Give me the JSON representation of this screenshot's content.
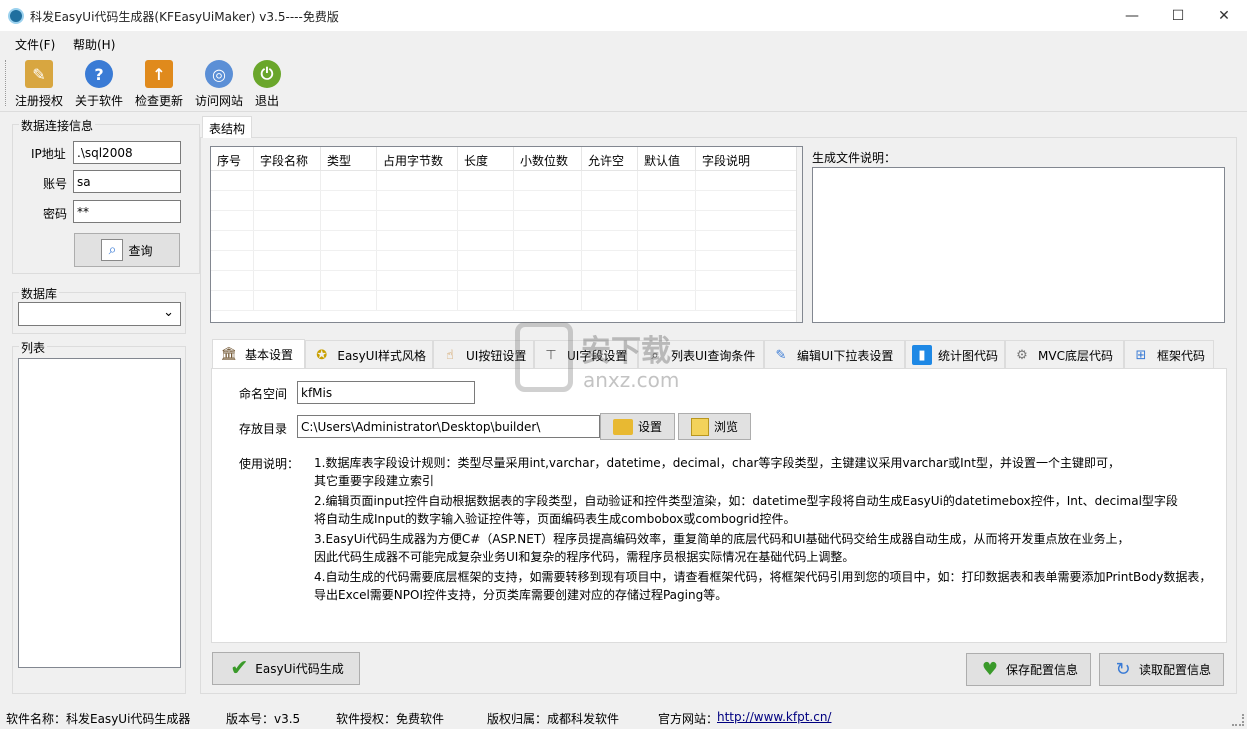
{
  "window": {
    "title": "科发EasyUi代码生成器(KFEasyUiMaker) v3.5----免费版",
    "min": "—",
    "max": "☐",
    "close": "✕"
  },
  "menu": [
    "文件(F)",
    "帮助(H)"
  ],
  "toolbar": [
    {
      "label": "注册授权",
      "icon": "key-document-icon",
      "color": "#d8a640",
      "glyph": "✎"
    },
    {
      "label": "关于软件",
      "icon": "help-icon",
      "color": "#3a7bd5",
      "glyph": "?"
    },
    {
      "label": "检查更新",
      "icon": "update-icon",
      "color": "#e08a1c",
      "glyph": "↑"
    },
    {
      "label": "访问网站",
      "icon": "globe-icon",
      "color": "#5b8fd6",
      "glyph": "◎"
    },
    {
      "label": "退出",
      "icon": "exit-icon",
      "color": "#6aa62b",
      "glyph": "⏻"
    }
  ],
  "connection": {
    "title": "数据连接信息",
    "ip_label": "IP地址",
    "ip_value": ".\\sql2008",
    "user_label": "账号",
    "user_value": "sa",
    "pwd_label": "密码",
    "pwd_value": "**",
    "query_button": "查询"
  },
  "database": {
    "title": "数据库",
    "selected": ""
  },
  "tables": {
    "title": "列表"
  },
  "structure": {
    "tab": "表结构",
    "columns": [
      "序号",
      "字段名称",
      "类型",
      "占用字节数",
      "长度",
      "小数位数",
      "允许空",
      "默认值",
      "字段说明"
    ]
  },
  "output_desc": {
    "label": "生成文件说明："
  },
  "tabs": [
    {
      "label": "基本设置",
      "icon": "bank-icon"
    },
    {
      "label": "EasyUI样式风格",
      "icon": "medal-icon"
    },
    {
      "label": "UI按钮设置",
      "icon": "pointer-hand-icon"
    },
    {
      "label": "UI字段设置",
      "icon": "pin-icon"
    },
    {
      "label": "列表UI查询条件",
      "icon": "magnifier-icon"
    },
    {
      "label": "编辑UI下拉表设置",
      "icon": "pencil-icon"
    },
    {
      "label": "统计图代码",
      "icon": "chart-icon"
    },
    {
      "label": "MVC底层代码",
      "icon": "gear-icon"
    },
    {
      "label": "框架代码",
      "icon": "hierarchy-icon"
    }
  ],
  "basic": {
    "namespace_label": "命名空间",
    "namespace_value": "kfMis",
    "dir_label": "存放目录",
    "dir_value": "C:\\Users\\Administrator\\Desktop\\builder\\",
    "set_button": "设置",
    "browse_button": "浏览",
    "usage_label": "使用说明：",
    "usage_lines": [
      "1.数据库表字段设计规则：类型尽量采用int,varchar，datetime，decimal，char等字段类型，主键建议采用varchar或Int型，并设置一个主键即可，",
      "其它重要字段建立索引",
      "2.编辑页面input控件自动根据数据表的字段类型，自动验证和控件类型渲染，如：datetime型字段将自动生成EasyUi的datetimebox控件，Int、decimal型字段",
      "将自动生成Input的数字输入验证控件等，页面编码表生成combobox或combogrid控件。",
      "3.EasyUi代码生成器为方便C#（ASP.NET）程序员提高编码效率，重复简单的底层代码和UI基础代码交给生成器自动生成，从而将开发重点放在业务上，",
      "因此代码生成器不可能完成复杂业务UI和复杂的程序代码，需程序员根据实际情况在基础代码上调整。",
      "4.自动生成的代码需要底层框架的支持，如需要转移到现有项目中，请查看框架代码，将框架代码引用到您的项目中，如：打印数据表和表单需要添加PrintBody数据表，",
      "导出Excel需要NPOI控件支持，分页类库需要创建对应的存储过程Paging等。"
    ]
  },
  "actions": {
    "generate": "EasyUi代码生成",
    "save": "保存配置信息",
    "load": "读取配置信息"
  },
  "watermark": {
    "main": "安下载",
    "sub": "anxz.com"
  },
  "status": {
    "name": "软件名称：科发EasyUi代码生成器",
    "version": "版本号：v3.5",
    "license": "软件授权：免费软件",
    "owner": "版权归属：成都科发软件",
    "site_label": "官方网站：",
    "site_url": "http://www.kfpt.cn/"
  },
  "colors": {
    "accent": "#1f6f9f",
    "link": "#000080"
  }
}
